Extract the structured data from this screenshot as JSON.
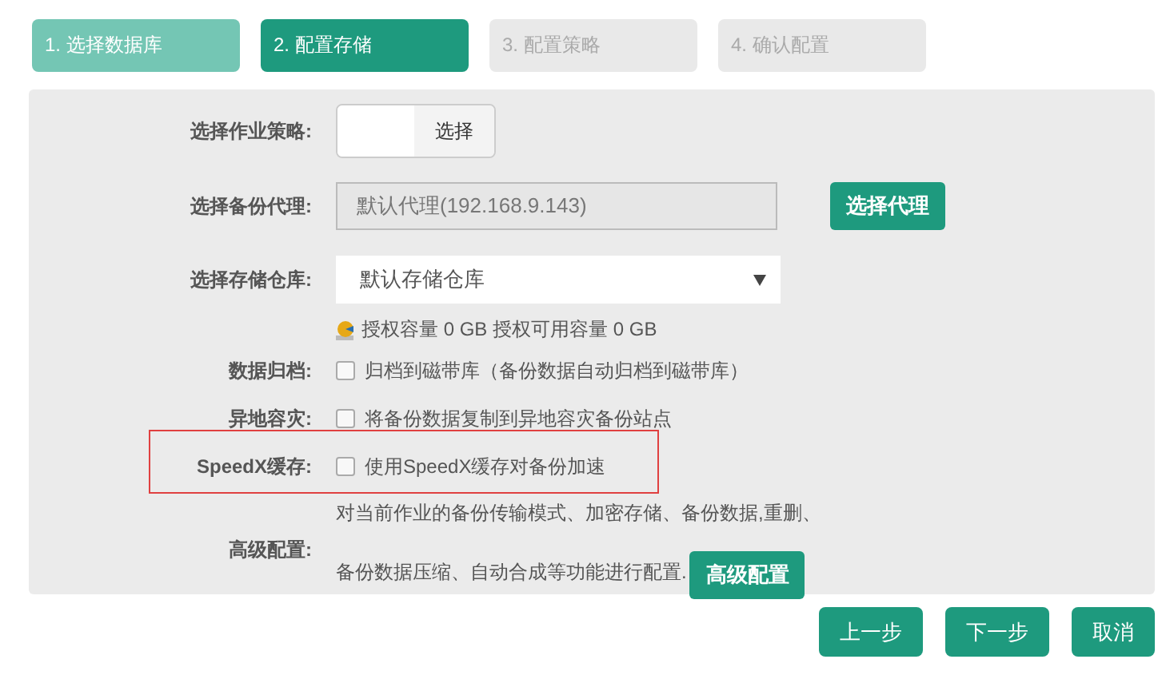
{
  "steps": [
    {
      "label": "1. 选择数据库",
      "done": true,
      "selected": false
    },
    {
      "label": "2. 配置存储",
      "done": false,
      "selected": true
    },
    {
      "label": "3. 配置策略",
      "done": false,
      "selected": false
    },
    {
      "label": "4. 确认配置",
      "done": false,
      "selected": false
    }
  ],
  "form": {
    "rows": [
      {
        "kind": "picker",
        "label": "选择作业策略:",
        "button": "选择"
      },
      {
        "kind": "readonly",
        "label": "选择备份代理:",
        "value": "默认代理(192.168.9.143)",
        "button": "选择代理"
      },
      {
        "kind": "select",
        "label": "选择存储仓库:",
        "value": "默认存储仓库",
        "note": "授权容量 0 GB 授权可用容量 0 GB"
      },
      {
        "kind": "checkbox",
        "label": "数据归档:",
        "text": "归档到磁带库（备份数据自动归档到磁带库）",
        "checked": false,
        "highlighted": false
      },
      {
        "kind": "checkbox",
        "label": "异地容灾:",
        "text": "将备份数据复制到异地容灾备份站点",
        "checked": false,
        "highlighted": false
      },
      {
        "kind": "checkbox",
        "label": "SpeedX缓存:",
        "text": "使用SpeedX缓存对备份加速",
        "checked": false,
        "highlighted": true
      },
      {
        "kind": "advanced",
        "label": "高级配置:",
        "lines": [
          "对当前作业的备份传输模式、加密存储、备份数据,重删、",
          "备份数据压缩、自动合成等功能进行配置."
        ],
        "button": "高级配置"
      }
    ]
  },
  "footer": {
    "buttons": [
      "上一步",
      "下一步",
      "取消"
    ]
  }
}
